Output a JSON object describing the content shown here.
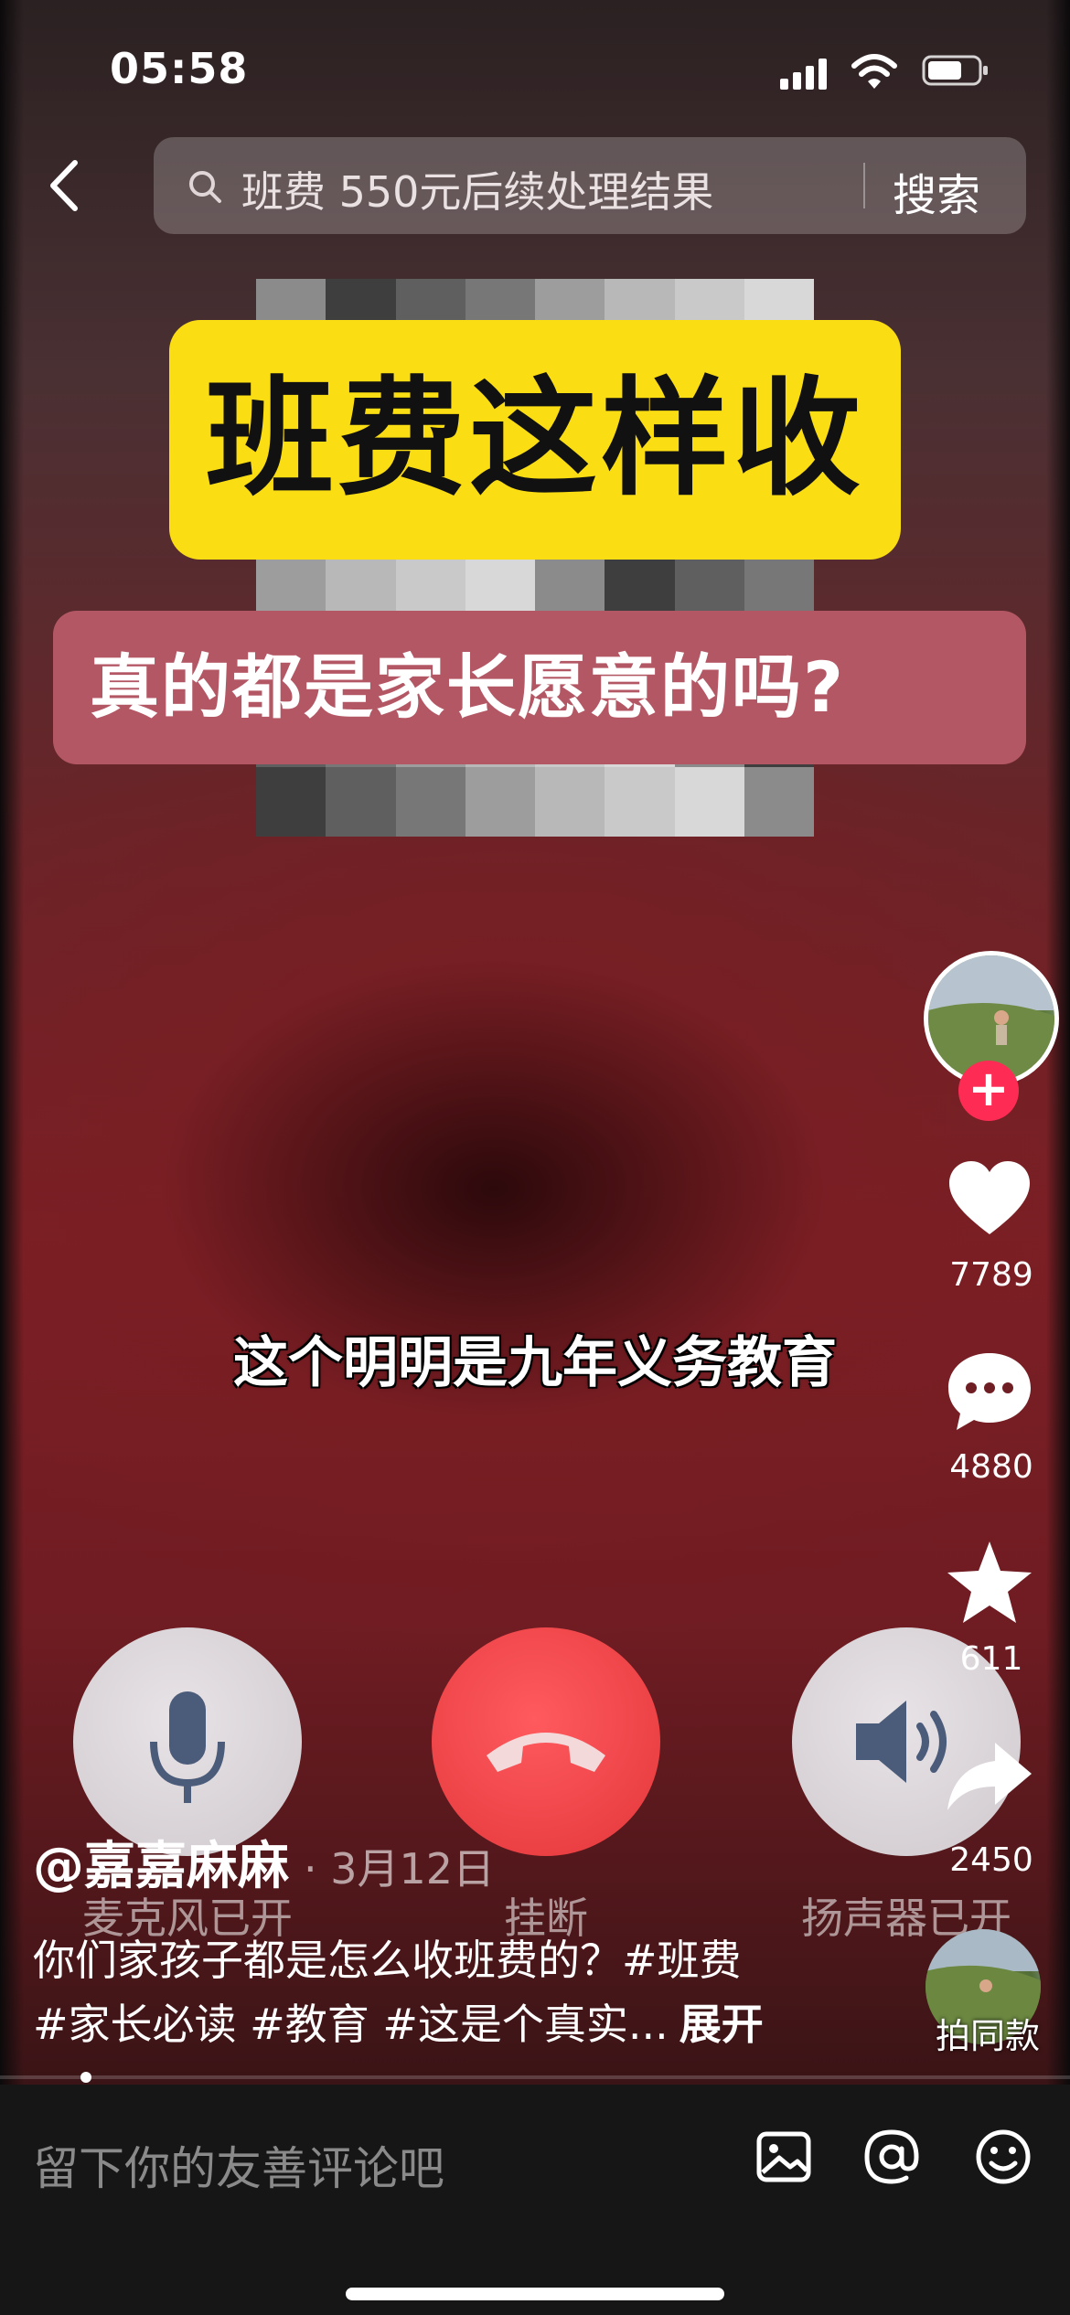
{
  "status_bar": {
    "time": "05:58"
  },
  "search": {
    "query": "班费 550元后续处理结果",
    "button": "搜索"
  },
  "cover": {
    "title": "班费这样收",
    "subtitle": "真的都是家长愿意的吗?"
  },
  "video": {
    "caption": "这个明明是九年义务教育"
  },
  "call_controls": [
    {
      "label": "麦克风已开",
      "icon": "microphone-icon"
    },
    {
      "label": "挂断",
      "icon": "hang-up-icon"
    },
    {
      "label": "扬声器已开",
      "icon": "speaker-icon"
    }
  ],
  "actions": {
    "likes": "7789",
    "comments": "4880",
    "favorites": "611",
    "shares": "2450",
    "same_style": "拍同款"
  },
  "post": {
    "author": "@嘉嘉麻麻",
    "date": "· 3月12日",
    "description_line1": "你们家孩子都是怎么收班费的？#班费",
    "description_line2": "#家长必读 #教育 #这是个真实...",
    "expand": "展开"
  },
  "comment_bar": {
    "placeholder": "留下你的友善评论吧"
  },
  "colors": {
    "accent_red": "#fe2c55",
    "cover_yellow": "#fadd13",
    "cover_pink": "#b45764"
  }
}
